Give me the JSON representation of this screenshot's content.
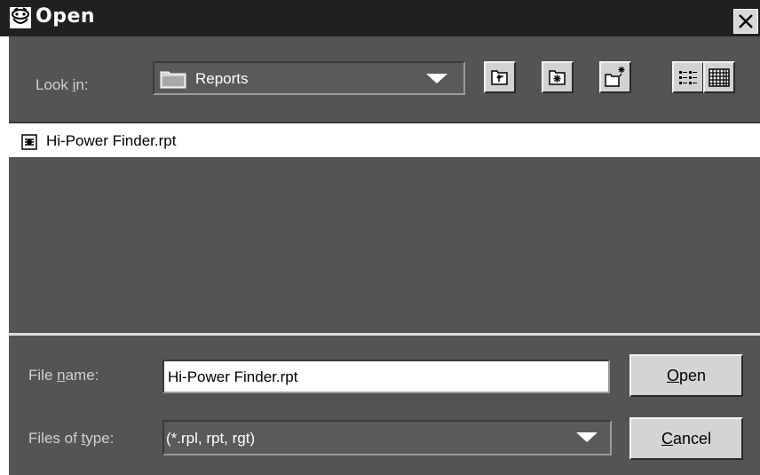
{
  "window": {
    "title": "Open"
  },
  "toolbar": {
    "look_in_label": "Look in:",
    "look_in_value": "Reports",
    "buttons": [
      {
        "icon": "up-one-level-icon"
      },
      {
        "icon": "home-icon"
      },
      {
        "icon": "new-folder-icon"
      },
      {
        "icon": "list-view-icon"
      },
      {
        "icon": "details-view-icon"
      }
    ]
  },
  "files": [
    {
      "name": "Hi-Power Finder.rpt",
      "icon": "report-file-icon",
      "selected": true
    }
  ],
  "form": {
    "file_name_label": "File name:",
    "file_name_value": "Hi-Power Finder.rpt",
    "files_of_type_label": "Files of type:",
    "files_of_type_value": "(*.rpl, rpt, rgt)",
    "open_label": "Open",
    "cancel_label": "Cancel"
  },
  "colors": {
    "titlebar": "#202020",
    "panel": "#545454",
    "button_face": "#d4d4d4"
  }
}
